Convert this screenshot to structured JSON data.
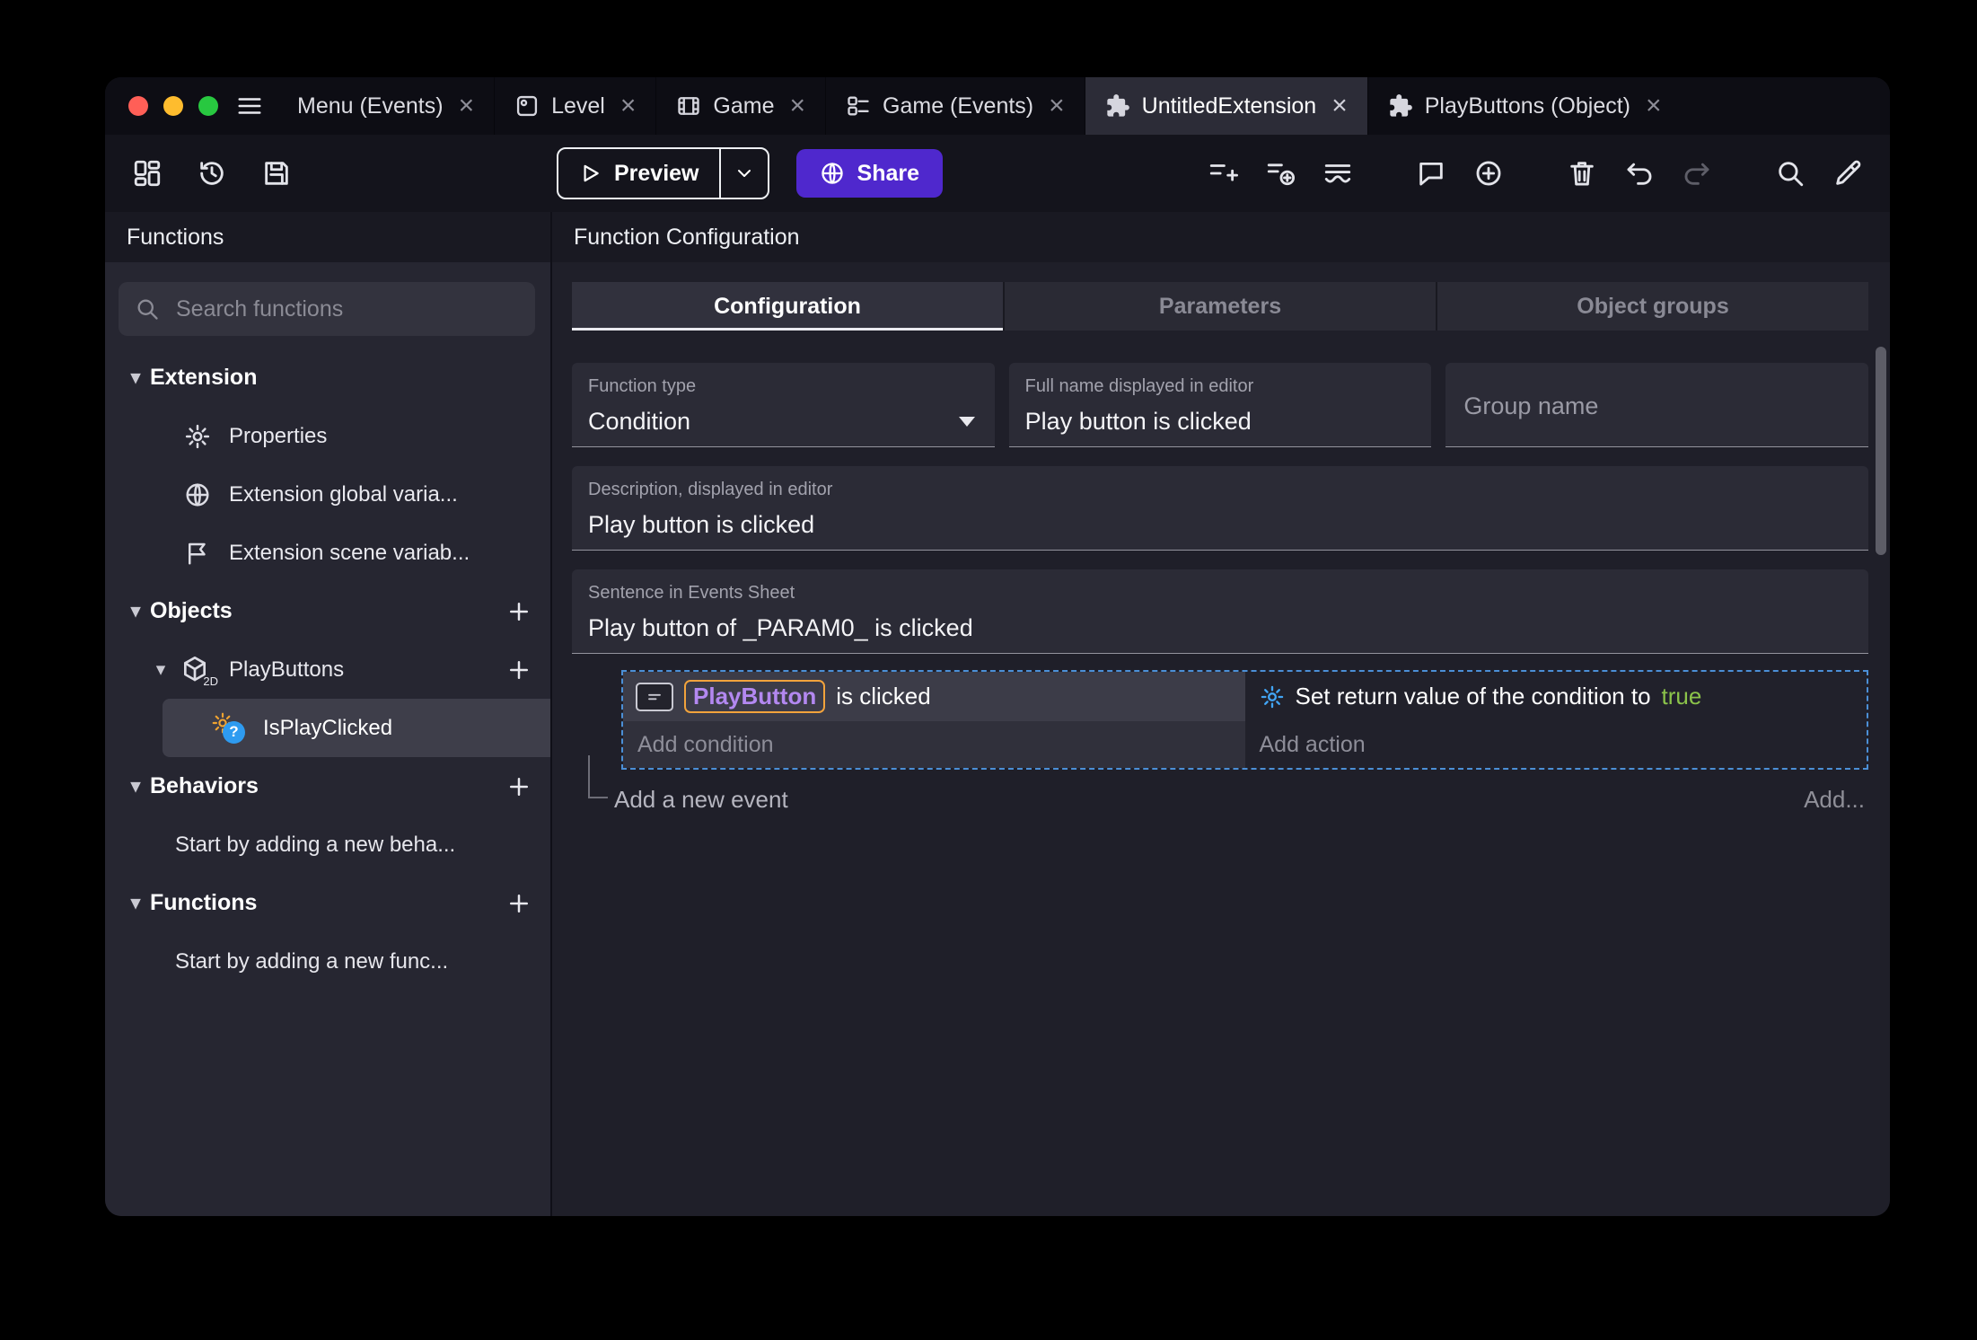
{
  "glyphs": {
    "close": "×",
    "caret_down": "▾"
  },
  "colors": {
    "accent_purple": "#4f28cd",
    "selection_dashed_border": "#4b8fd6",
    "object_chip_text": "#b388f0",
    "object_chip_border": "#f2a33c",
    "true_value_green": "#8bc34a",
    "action_gear_blue": "#42a5f5"
  },
  "window": {
    "tabs": [
      {
        "label": "Menu (Events)",
        "icon": null,
        "active": false
      },
      {
        "label": "Level",
        "icon": "scene-icon",
        "active": false
      },
      {
        "label": "Game",
        "icon": "film-icon",
        "active": false
      },
      {
        "label": "Game (Events)",
        "icon": "events-icon",
        "active": false
      },
      {
        "label": "UntitledExtension",
        "icon": "puzzle-icon",
        "active": true
      },
      {
        "label": "PlayButtons (Object)",
        "icon": "puzzle-icon",
        "active": false
      }
    ]
  },
  "toolbar": {
    "preview_label": "Preview",
    "share_label": "Share"
  },
  "sidebar": {
    "title": "Functions",
    "search_placeholder": "Search functions",
    "extension": {
      "label": "Extension",
      "items": [
        {
          "label": "Properties",
          "icon": "gear-icon"
        },
        {
          "label": "Extension global varia...",
          "icon": "globe-icon"
        },
        {
          "label": "Extension scene variab...",
          "icon": "flag-icon"
        }
      ]
    },
    "objects": {
      "label": "Objects",
      "object_label": "PlayButtons",
      "object_badge": "2D",
      "function_label": "IsPlayClicked"
    },
    "behaviors": {
      "label": "Behaviors",
      "hint": "Start by adding a new beha..."
    },
    "functions": {
      "label": "Functions",
      "hint": "Start by adding a new func..."
    }
  },
  "main": {
    "title": "Function Configuration",
    "tabs": [
      {
        "label": "Configuration",
        "active": true
      },
      {
        "label": "Parameters",
        "active": false
      },
      {
        "label": "Object groups",
        "active": false
      }
    ],
    "fields": {
      "function_type": {
        "label": "Function type",
        "value": "Condition"
      },
      "full_name": {
        "label": "Full name displayed in editor",
        "value": "Play button is clicked"
      },
      "group_name": {
        "placeholder": "Group name"
      },
      "description": {
        "label": "Description, displayed in editor",
        "value": "Play button is clicked"
      },
      "sentence": {
        "label": "Sentence in Events Sheet",
        "value": "Play button of _PARAM0_ is clicked"
      }
    },
    "events": {
      "condition_object": "PlayButton",
      "condition_text": "is clicked",
      "add_condition": "Add condition",
      "action_text": "Set return value of the condition to",
      "action_value": "true",
      "add_action": "Add action",
      "add_new_event": "Add a new event",
      "add_more": "Add..."
    }
  }
}
